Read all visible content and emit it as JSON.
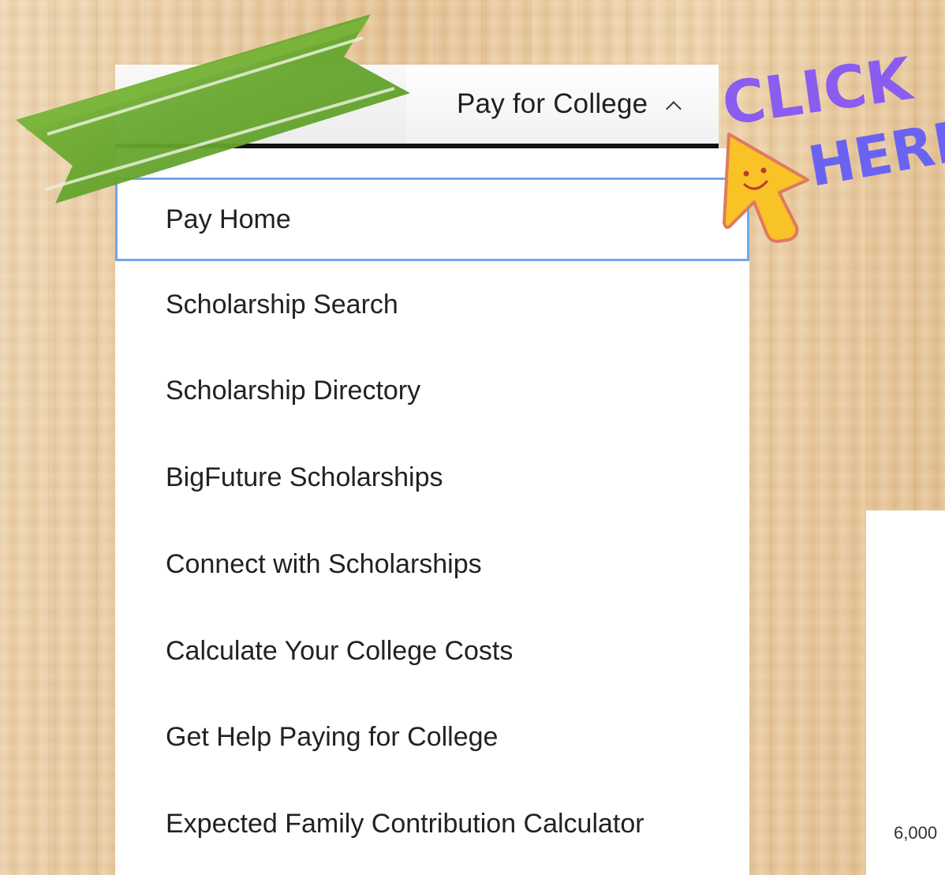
{
  "nav": {
    "trigger_label": "Pay for College",
    "trigger_icon": "chevron-up-icon"
  },
  "dropdown": {
    "items": [
      {
        "label": "Pay Home",
        "focused": true
      },
      {
        "label": "Scholarship Search"
      },
      {
        "label": "Scholarship Directory"
      },
      {
        "label": "BigFuture Scholarships"
      },
      {
        "label": "Connect with Scholarships"
      },
      {
        "label": "Calculate Your College Costs"
      },
      {
        "label": "Get Help Paying for College"
      },
      {
        "label": "Expected Family Contribution Calculator"
      }
    ],
    "focus_color": "#6fa6ee"
  },
  "decoration": {
    "callout_text_line1": "CLICK",
    "callout_text_line2": "HERE",
    "callout_color": "#8a5cf0",
    "ribbon_color": "#6faa32",
    "pointer_icon": "smiley-arrow-cursor-icon"
  },
  "side_panel": {
    "axis_tick": "6,000"
  }
}
